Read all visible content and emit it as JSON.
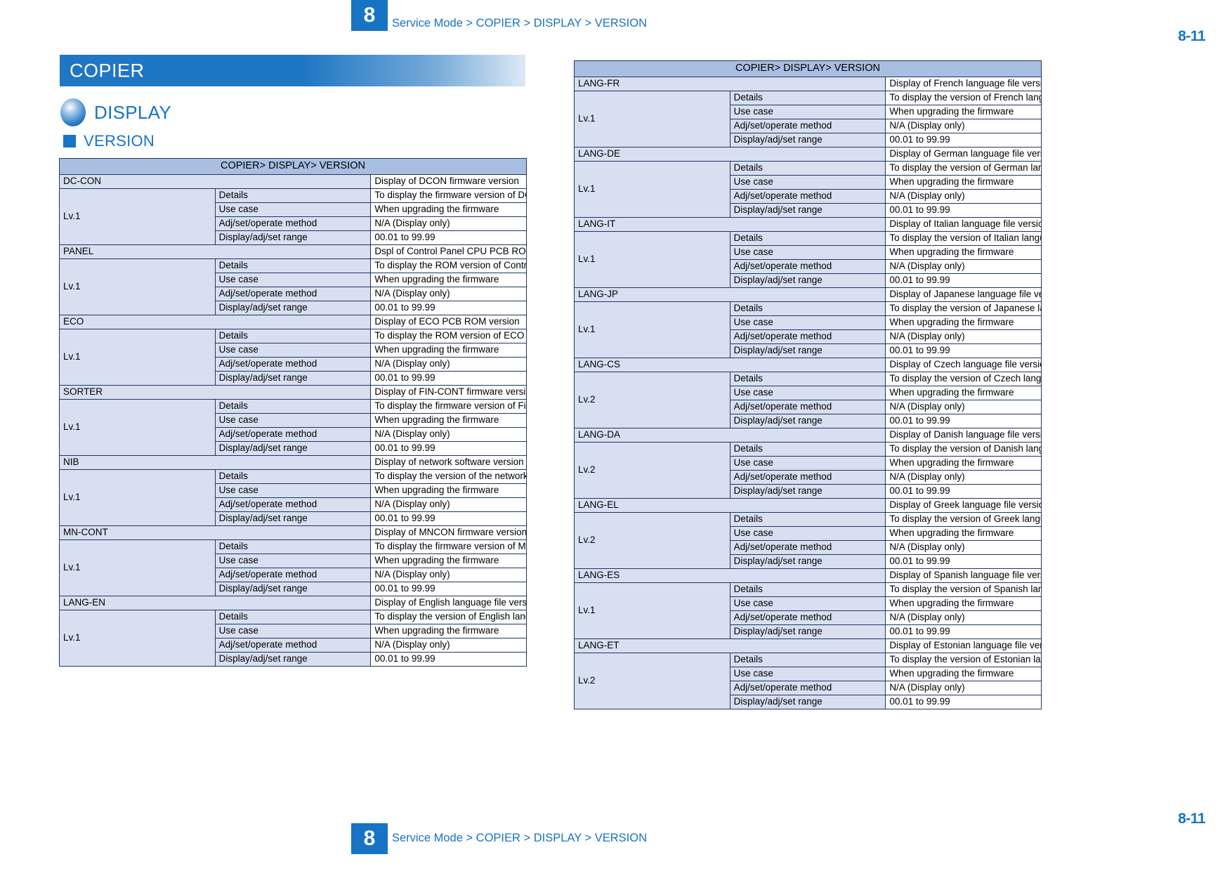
{
  "header": {
    "chapter": "8",
    "breadcrumb": "Service Mode > COPIER > DISPLAY > VERSION",
    "page_number": "8-11"
  },
  "footer": {
    "chapter": "8",
    "breadcrumb": "Service Mode > COPIER > DISPLAY > VERSION",
    "page_number": "8-11"
  },
  "section": {
    "banner_title": "COPIER",
    "subsection_title": "DISPLAY",
    "subsubsection_title": "VERSION"
  },
  "colors": {
    "accent_blue": "#1773c3",
    "banner_blue": "#1e76c4",
    "table_title_bg": "#a8bfe2",
    "table_label_bg": "#d8dff1",
    "table_border": "#20365c"
  },
  "field_labels": {
    "details": "Details",
    "use_case": "Use case",
    "adj_method": "Adj/set/operate method",
    "display_range": "Display/adj/set range"
  },
  "tables": [
    {
      "title": "COPIER> DISPLAY> VERSION",
      "entries": [
        {
          "item": "DC-CON",
          "item_desc": "Display of DCON firmware version",
          "level": "Lv.1",
          "details": "To display the firmware version of DC Controller PCB.",
          "use_case": "When upgrading the firmware",
          "adj_method": "N/A (Display only)",
          "display_range": "00.01 to 99.99"
        },
        {
          "item": "PANEL",
          "item_desc": "Dspl of Control Panel CPU PCB ROM ver",
          "level": "Lv.1",
          "details": "To display the ROM version of Control Panel CPU PCB.",
          "use_case": "When upgrading the firmware",
          "adj_method": "N/A (Display only)",
          "display_range": "00.01 to 99.99"
        },
        {
          "item": "ECO",
          "item_desc": "Display of ECO PCB ROM version",
          "level": "Lv.1",
          "details": "To display the ROM version of ECO PCB",
          "use_case": "When upgrading the firmware",
          "adj_method": "N/A (Display only)",
          "display_range": "00.01 to 99.99"
        },
        {
          "item": "SORTER",
          "item_desc": "Display of FIN-CONT firmware version",
          "level": "Lv.1",
          "details": "To display the firmware version of Finisher Controller PCB.",
          "use_case": "When upgrading the firmware",
          "adj_method": "N/A (Display only)",
          "display_range": "00.01 to 99.99"
        },
        {
          "item": "NIB",
          "item_desc": "Display of network software version",
          "level": "Lv.1",
          "details": "To display the version of the network software.",
          "use_case": "When upgrading the firmware",
          "adj_method": "N/A (Display only)",
          "display_range": "00.01 to 99.99"
        },
        {
          "item": "MN-CONT",
          "item_desc": "Display of MNCON firmware version",
          "level": "Lv.1",
          "details": "To display the firmware version of Main Controller PCB.",
          "use_case": "When upgrading the firmware",
          "adj_method": "N/A (Display only)",
          "display_range": "00.01 to 99.99"
        },
        {
          "item": "LANG-EN",
          "item_desc": "Display of English language file version",
          "level": "Lv.1",
          "details": "To display the version of English language file.",
          "use_case": "When upgrading the firmware",
          "adj_method": "N/A (Display only)",
          "display_range": "00.01 to 99.99"
        }
      ]
    },
    {
      "title": "COPIER> DISPLAY> VERSION",
      "entries": [
        {
          "item": "LANG-FR",
          "item_desc": "Display of French language file version",
          "level": "Lv.1",
          "details": "To display the version of French language file.",
          "use_case": "When upgrading the firmware",
          "adj_method": "N/A (Display only)",
          "display_range": "00.01 to 99.99"
        },
        {
          "item": "LANG-DE",
          "item_desc": "Display of German language file version",
          "level": "Lv.1",
          "details": "To display the version of German language file.",
          "use_case": "When upgrading the firmware",
          "adj_method": "N/A (Display only)",
          "display_range": "00.01 to 99.99"
        },
        {
          "item": "LANG-IT",
          "item_desc": "Display of Italian language file version",
          "level": "Lv.1",
          "details": "To display the version of Italian language file.",
          "use_case": "When upgrading the firmware",
          "adj_method": "N/A (Display only)",
          "display_range": "00.01 to 99.99"
        },
        {
          "item": "LANG-JP",
          "item_desc": "Display of Japanese language file ver",
          "level": "Lv.1",
          "details": "To display the version of Japanese language file.",
          "use_case": "When upgrading the firmware",
          "adj_method": "N/A (Display only)",
          "display_range": "00.01 to 99.99"
        },
        {
          "item": "LANG-CS",
          "item_desc": "Display of Czech language file version",
          "level": "Lv.2",
          "details": "To display the version of Czech language file.",
          "use_case": "When upgrading the firmware",
          "adj_method": "N/A (Display only)",
          "display_range": "00.01 to 99.99"
        },
        {
          "item": "LANG-DA",
          "item_desc": "Display of Danish language file version",
          "level": "Lv.2",
          "details": "To display the version of Danish language file.",
          "use_case": "When upgrading the firmware",
          "adj_method": "N/A (Display only)",
          "display_range": "00.01 to 99.99"
        },
        {
          "item": "LANG-EL",
          "item_desc": "Display of Greek language file version",
          "level": "Lv.2",
          "details": "To display the version of Greek language file.",
          "use_case": "When upgrading the firmware",
          "adj_method": "N/A (Display only)",
          "display_range": "00.01 to 99.99"
        },
        {
          "item": "LANG-ES",
          "item_desc": "Display of Spanish language file version",
          "level": "Lv.1",
          "details": "To display the version of Spanish language file.",
          "use_case": "When upgrading the firmware",
          "adj_method": "N/A (Display only)",
          "display_range": "00.01 to 99.99"
        },
        {
          "item": "LANG-ET",
          "item_desc": "Display of Estonian language file ver",
          "level": "Lv.2",
          "details": "To display the version of Estonian language file.",
          "use_case": "When upgrading the firmware",
          "adj_method": "N/A (Display only)",
          "display_range": "00.01 to 99.99"
        }
      ]
    }
  ]
}
